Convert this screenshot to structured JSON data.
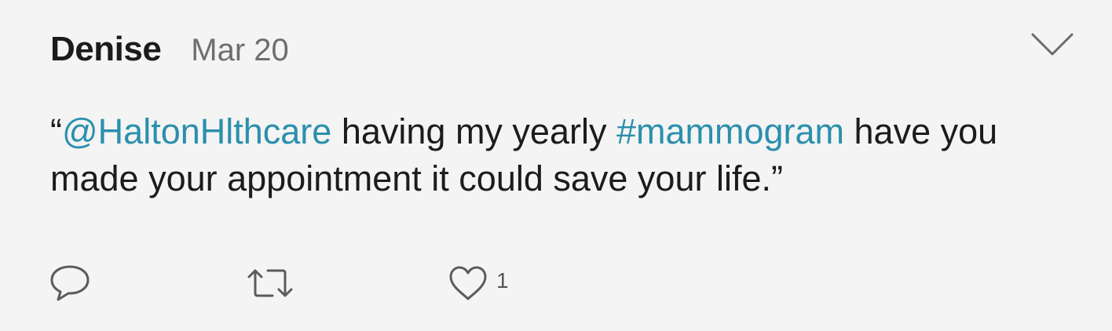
{
  "tweet": {
    "author": "Denise",
    "date": "Mar 20",
    "quote_open": "“",
    "mention": "@HaltonHlthcare",
    "text_part1": " having my yearly ",
    "hashtag": "#mammogram",
    "text_part2": " have you made your appointment it could save your life.",
    "quote_close": "”"
  },
  "actions": {
    "reply_icon": "speech-bubble-icon",
    "retweet_icon": "retweet-arrows-icon",
    "like_icon": "heart-icon",
    "like_count": "1",
    "menu_icon": "chevron-down-icon"
  },
  "colors": {
    "background": "#f3f4f3",
    "link": "#2b8fad",
    "text": "#1c1c1c",
    "muted": "#6e6e6e",
    "icon": "#5b5b5b"
  }
}
